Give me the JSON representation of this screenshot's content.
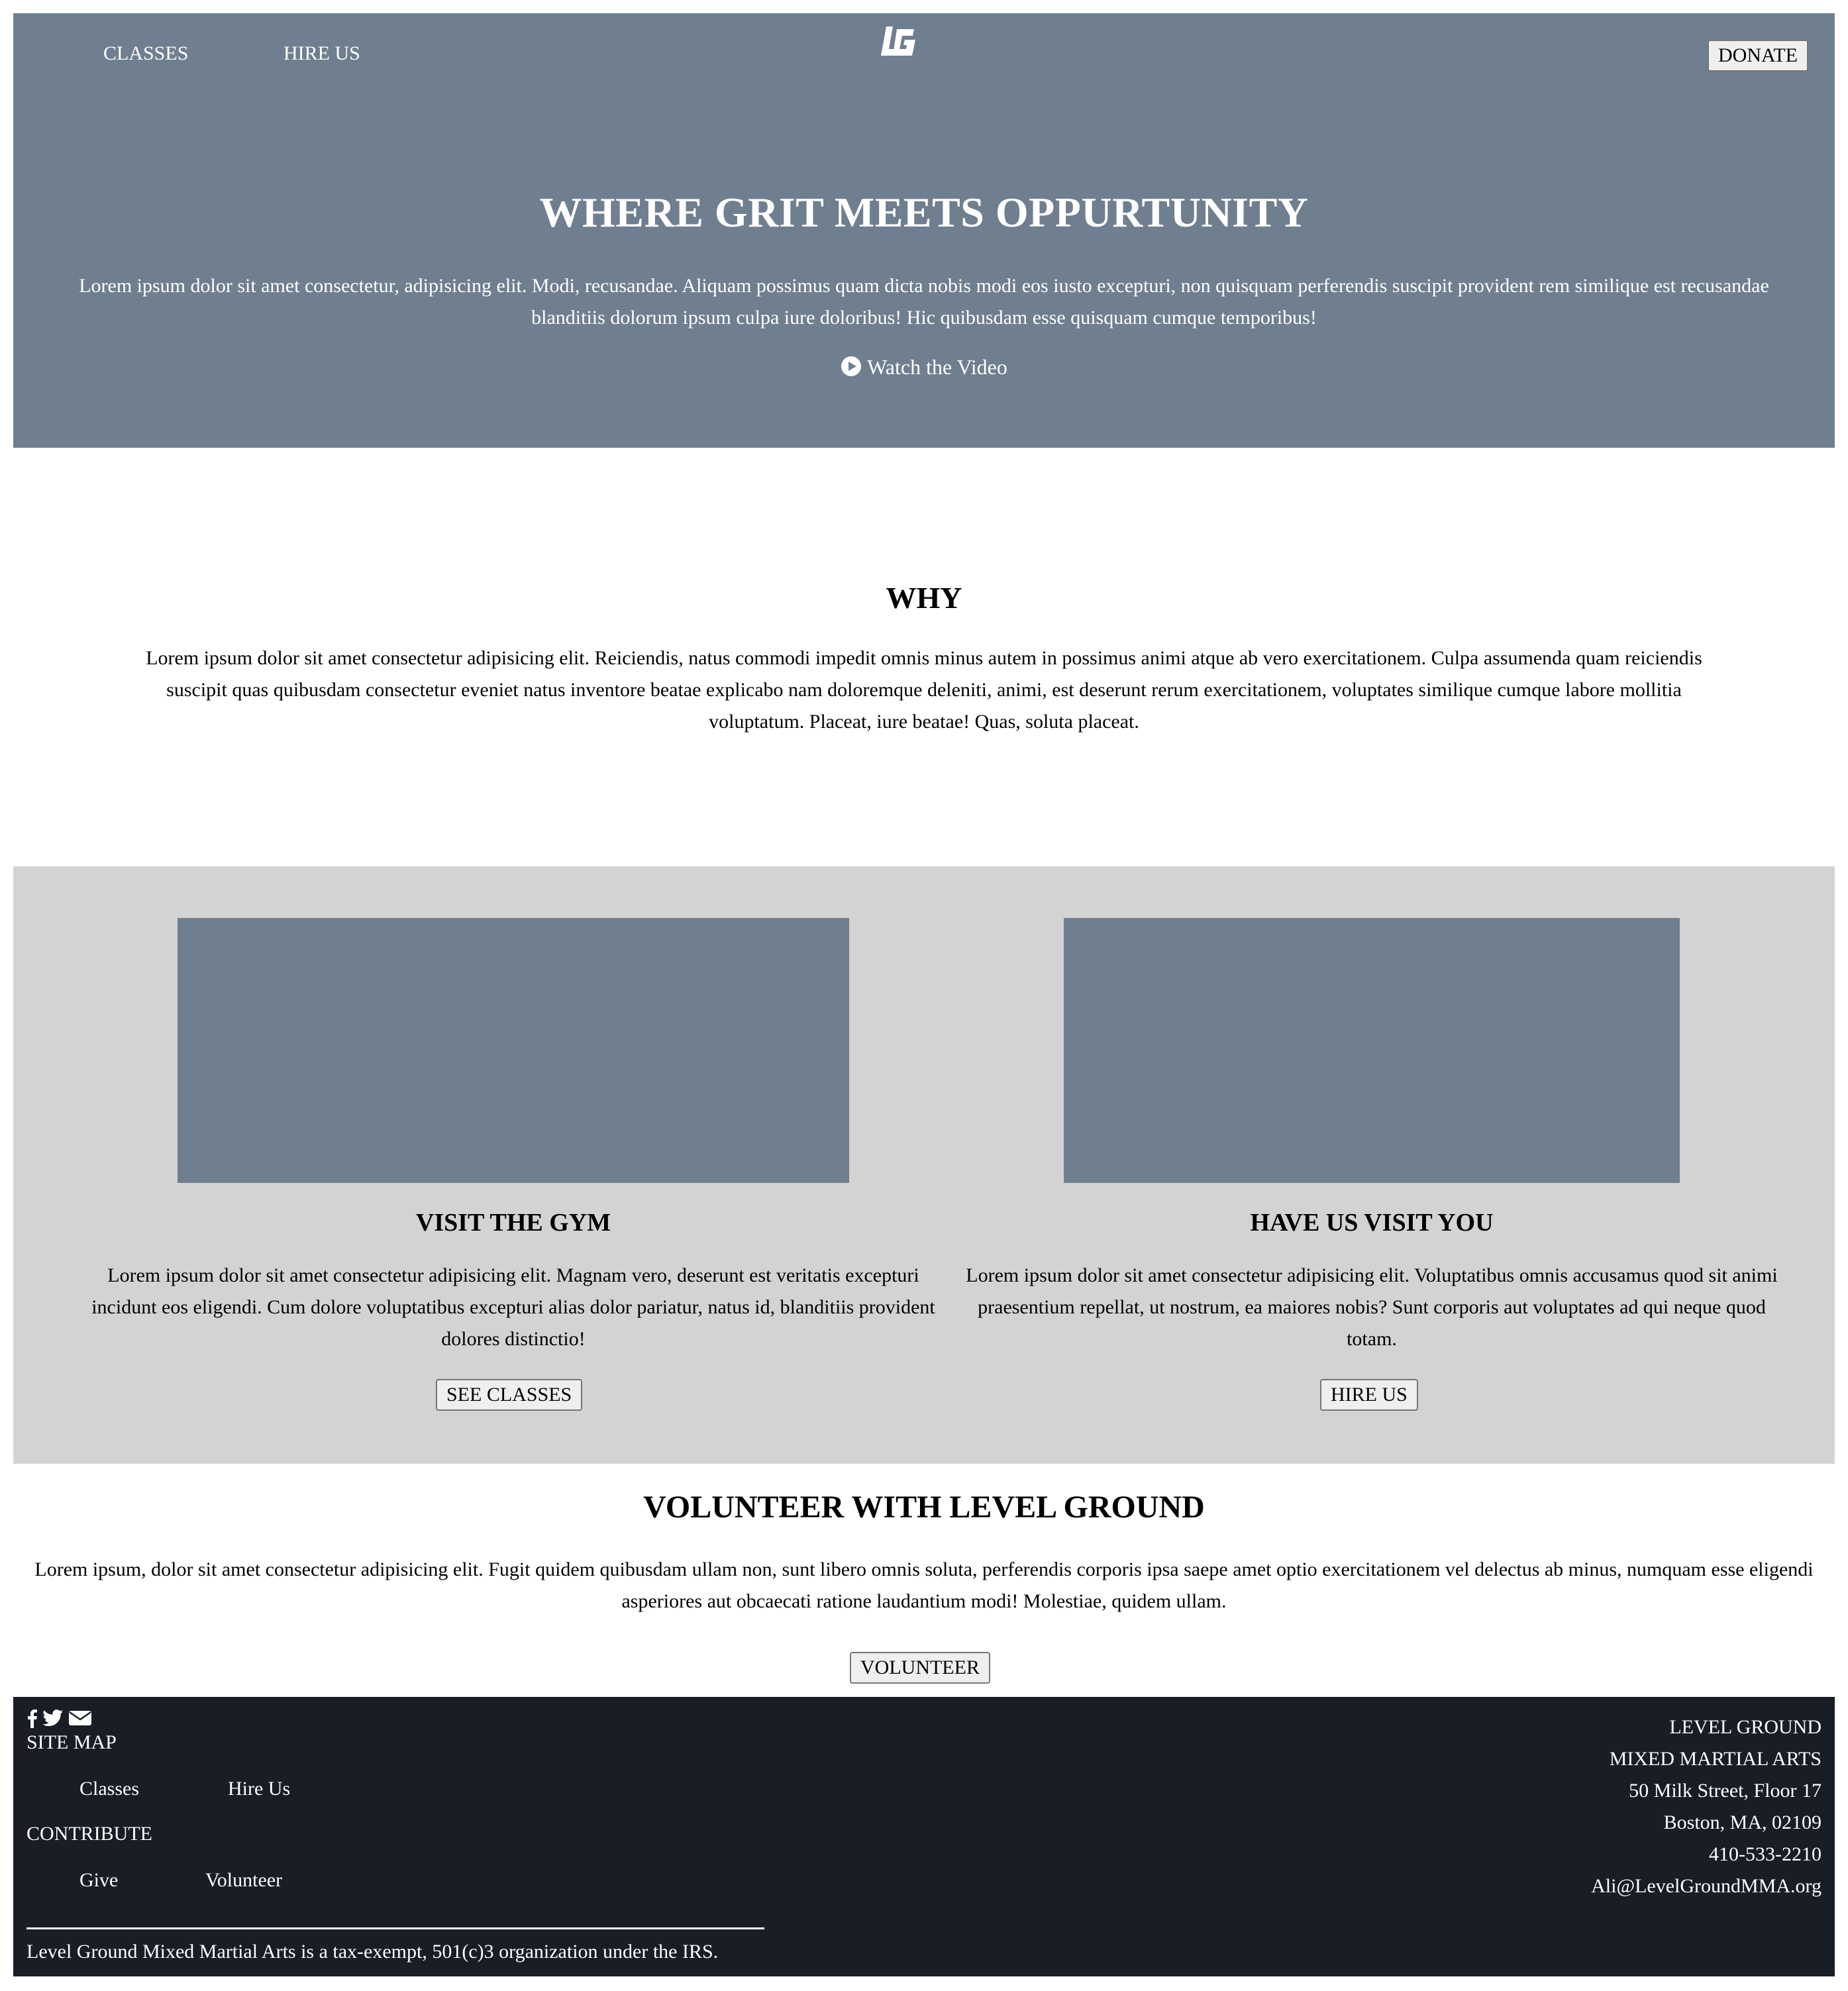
{
  "colors": {
    "hero_bg": "#6f7f8f",
    "features_bg": "#d3d3d3",
    "footer_bg": "#181d26",
    "text_light": "#ffffff"
  },
  "nav": {
    "classes_label": "CLASSES",
    "hire_label": "HIRE US",
    "logo_text": "LG",
    "donate_label": "DONATE"
  },
  "hero": {
    "title": "WHERE GRIT MEETS OPPURTUNITY",
    "text": "Lorem ipsum dolor sit amet consectetur, adipisicing elit. Modi, recusandae. Aliquam possimus quam dicta nobis modi eos iusto excepturi, non quisquam perferendis suscipit provident rem similique est recusandae blanditiis dolorum ipsum culpa iure doloribus! Hic quibusdam esse quisquam cumque temporibus!",
    "watch_label": "Watch the Video",
    "watch_icon": "play-circle-icon"
  },
  "why": {
    "title": "WHY",
    "text": "Lorem ipsum dolor sit amet consectetur adipisicing elit. Reiciendis, natus commodi impedit omnis minus autem in possimus animi atque ab vero exercitationem. Culpa assumenda quam reiciendis suscipit quas quibusdam consectetur eveniet natus inventore beatae explicabo nam doloremque deleniti, animi, est deserunt rerum exercitationem, voluptates similique cumque labore mollitia voluptatum. Placeat, iure beatae! Quas, soluta placeat."
  },
  "cards": [
    {
      "title": "VISIT THE GYM",
      "text": "Lorem ipsum dolor sit amet consectetur adipisicing elit. Magnam vero, deserunt est veritatis excepturi incidunt eos eligendi. Cum dolore voluptatibus excepturi alias dolor pariatur, natus id, blanditiis provident dolores distinctio!",
      "button": "SEE CLASSES"
    },
    {
      "title": "HAVE US VISIT YOU",
      "text": "Lorem ipsum dolor sit amet consectetur adipisicing elit. Voluptatibus omnis accusamus quod sit animi praesentium repellat, ut nostrum, ea maiores nobis? Sunt corporis aut voluptates ad qui neque quod totam.",
      "button": "HIRE US"
    }
  ],
  "volunteer": {
    "title": "VOLUNTEER WITH LEVEL GROUND",
    "text": "Lorem ipsum, dolor sit amet consectetur adipisicing elit. Fugit quidem quibusdam ullam non, sunt libero omnis soluta, perferendis corporis ipsa saepe amet optio exercitationem vel delectus ab minus, numquam esse eligendi asperiores aut obcaecati ratione laudantium modi! Molestiae, quidem ullam.",
    "button": "VOLUNTEER"
  },
  "footer": {
    "social_icons": [
      "facebook-icon",
      "twitter-icon",
      "envelope-icon"
    ],
    "site_map_heading": "SITE MAP",
    "site_map_links": [
      "Classes",
      "Hire Us"
    ],
    "contribute_heading": "CONTRIBUTE",
    "contribute_links": [
      "Give",
      "Volunteer"
    ],
    "legal": "Level Ground Mixed Martial Arts is a tax-exempt, 501(c)3 organization under the IRS.",
    "address": {
      "line1": "LEVEL GROUND",
      "line2": "MIXED MARTIAL ARTS",
      "line3": "50 Milk Street, Floor 17",
      "line4": "Boston, MA, 02109",
      "phone": "410-533-2210",
      "email": "Ali@LevelGroundMMA.org"
    }
  }
}
